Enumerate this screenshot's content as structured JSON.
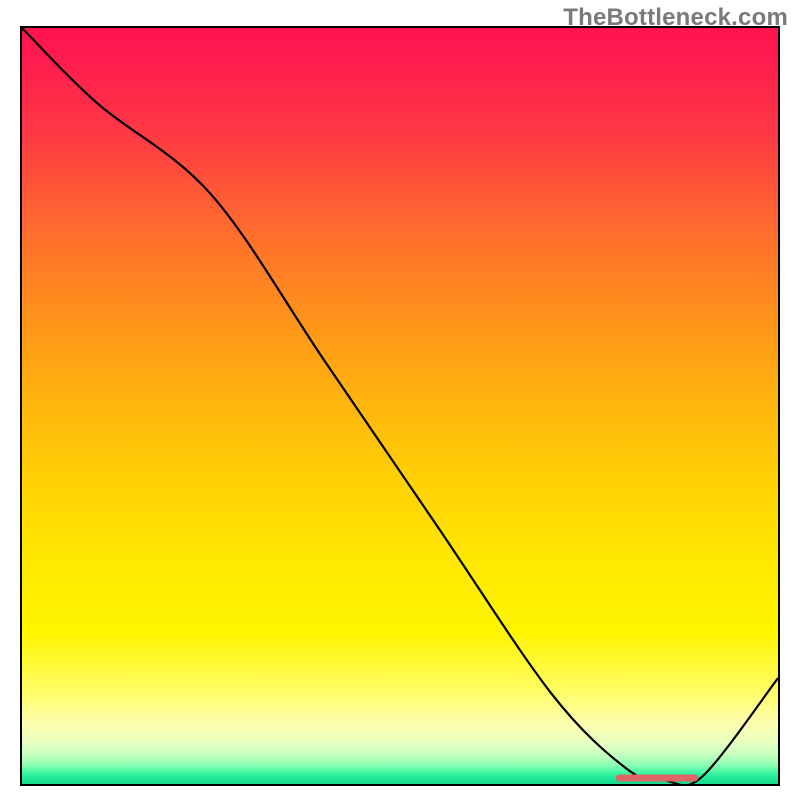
{
  "watermark": "TheBottleneck.com",
  "chart_data": {
    "type": "line",
    "title": "",
    "xlabel": "",
    "ylabel": "",
    "xlim": [
      0,
      100
    ],
    "ylim": [
      0,
      100
    ],
    "grid": false,
    "legend": false,
    "series": [
      {
        "name": "bottleneck-curve",
        "x": [
          0,
          10,
          25,
          40,
          55,
          70,
          80,
          85,
          90,
          100
        ],
        "y": [
          100,
          90,
          78,
          56,
          34,
          12,
          2,
          0.5,
          1,
          14
        ],
        "color": "#000000"
      }
    ],
    "marker": {
      "name": "optimal-range",
      "x_range": [
        79,
        89
      ],
      "y": 0.8,
      "color": "#e06666"
    },
    "background_gradient_stops": [
      {
        "pos": 0,
        "color": "#ff1450"
      },
      {
        "pos": 14,
        "color": "#ff3944"
      },
      {
        "pos": 30,
        "color": "#ff7728"
      },
      {
        "pos": 50,
        "color": "#ffb60d"
      },
      {
        "pos": 70,
        "color": "#ffe701"
      },
      {
        "pos": 88,
        "color": "#fffd6a"
      },
      {
        "pos": 96,
        "color": "#c8ffbe"
      },
      {
        "pos": 100,
        "color": "#15d98c"
      }
    ]
  }
}
